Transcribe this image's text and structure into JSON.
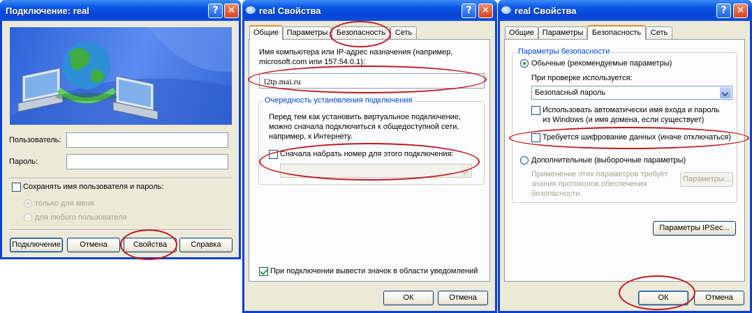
{
  "dialog1": {
    "title": "Подключение: real",
    "user_label": "Пользователь:",
    "user_value": "",
    "password_label": "Пароль:",
    "password_value": "",
    "save_checkbox_label": "Сохранять имя пользователя и пароль:",
    "radio_me_only": "только для меня",
    "radio_any_user": "для любого пользователя",
    "btn_connect": "Подключение",
    "btn_cancel": "Отмена",
    "btn_properties": "Свойства",
    "btn_help": "Справка"
  },
  "dialog2": {
    "title": "real Свойства",
    "tabs": [
      "Общие",
      "Параметры",
      "Безопасность",
      "Сеть"
    ],
    "host_label_1": "Имя компьютера или IP-адрес назначения (например,",
    "host_label_2": "microsoft.com или 157.54.0.1):",
    "host_value": "l2tp.mai.ru",
    "group_title": "Очередность установления подключения",
    "group_text_1": "Перед тем как установить виртуальное подключение,",
    "group_text_2": "можно сначала подключиться к общедоступной сети,",
    "group_text_3": "например, к Интернету.",
    "dial_first_label": "Сначала набрать номер для этого подключения:",
    "dial_select_value": "",
    "notify_label": "При подключении вывести значок в области уведомлений",
    "btn_ok": "ОК",
    "btn_cancel": "Отмена"
  },
  "dialog3": {
    "title": "real Свойства",
    "tabs": [
      "Общие",
      "Параметры",
      "Безопасность",
      "Сеть"
    ],
    "group_title": "Параметры безопасности",
    "radio_typical": "Обычные (рекомендуемые параметры)",
    "verify_label": "При проверке используется:",
    "verify_value": "Безопасный пароль",
    "auto_login_1": "Использовать автоматически имя входа и пароль",
    "auto_login_2": "из Windows (и имя домена, если существует)",
    "require_encryption": "Требуется шифрование данных (иначе отключаться)",
    "radio_advanced": "Дополнительные (выборочные параметры)",
    "advanced_text_1": "Применение этих параметров требует",
    "advanced_text_2": "знания протоколов обеспечения",
    "advanced_text_3": "безопасности.",
    "btn_params": "Параметры...",
    "btn_ipsec": "Параметры IPSec...",
    "btn_ok": "ОК",
    "btn_cancel": "Отмена"
  },
  "colors": {
    "titlebar": "#0a56e6",
    "dialog_bg": "#ece9d8",
    "highlight_ellipse": "#c4161c",
    "active_tab_accent": "#e68b2c"
  }
}
